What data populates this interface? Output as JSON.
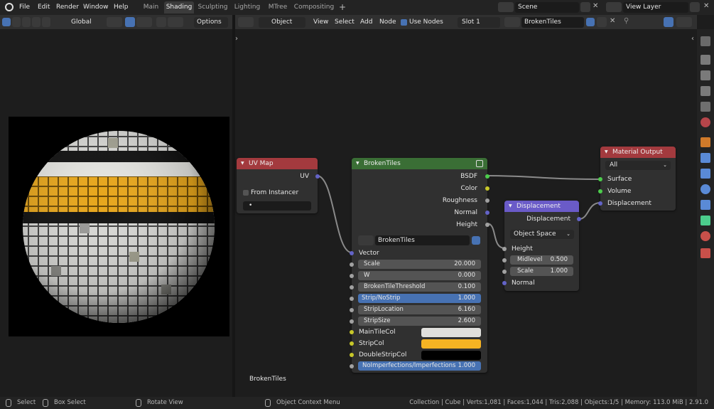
{
  "menu": {
    "file": "File",
    "edit": "Edit",
    "render": "Render",
    "window": "Window",
    "help": "Help"
  },
  "workspaces": [
    "Main",
    "Shading",
    "Sculpting",
    "Lighting",
    "MTree",
    "Compositing"
  ],
  "active_workspace": "Shading",
  "scene": {
    "value": "Scene"
  },
  "view_layer": {
    "value": "View Layer"
  },
  "left_header": {
    "orientation": "Global",
    "options": "Options",
    "search_placeholder": ""
  },
  "node_header": {
    "object": "Object",
    "view": "View",
    "select": "Select",
    "add": "Add",
    "node": "Node",
    "use_nodes": "Use Nodes",
    "slot": "Slot 1",
    "material": "BrokenTiles"
  },
  "uv_node": {
    "title": "UV Map",
    "out_uv": "UV",
    "from_instancer": "From Instancer",
    "field_value": "•"
  },
  "broken_node": {
    "title": "BrokenTiles",
    "outputs": [
      "BSDF",
      "Color",
      "Roughness",
      "Normal",
      "Height"
    ],
    "group_name": "BrokenTiles",
    "vector": "Vector",
    "props": [
      {
        "label": "Scale",
        "value": "20.000"
      },
      {
        "label": "W",
        "value": "0.000"
      },
      {
        "label": "BrokenTileThreshold",
        "value": "0.100"
      },
      {
        "label": "Strip/NoStrip",
        "value": "1.000"
      },
      {
        "label": "StripLocation",
        "value": "6.160"
      },
      {
        "label": "StripSize",
        "value": "2.600"
      }
    ],
    "colors": [
      {
        "label": "MainTileCol",
        "color": "#e0dfdc"
      },
      {
        "label": "StripCol",
        "color": "#f5b323"
      },
      {
        "label": "DoubleStripCol",
        "color": "#000000"
      }
    ],
    "last": {
      "label": "NoImperfections/Imperfections",
      "value": "1.000"
    }
  },
  "disp_node": {
    "title": "Displacement",
    "out": "Displacement",
    "space": "Object Space",
    "height": "Height",
    "midlevel_label": "Midlevel",
    "midlevel": "0.500",
    "scale_label": "Scale",
    "scale": "1.000",
    "normal": "Normal"
  },
  "out_node": {
    "title": "Material Output",
    "target": "All",
    "surface": "Surface",
    "volume": "Volume",
    "displacement": "Displacement"
  },
  "editor_label": "BrokenTiles",
  "status": {
    "select": "Select",
    "box_select": "Box Select",
    "rotate": "Rotate View",
    "context": "Object Context Menu",
    "info": "Collection | Cube | Verts:1,081 | Faces:1,044 | Tris:2,088 | Objects:1/5 | Memory: 113.0 MiB | 2.91.0"
  },
  "colors": {
    "accent": "#4772b3",
    "uv_header": "#a33a3e",
    "group_header": "#3a6e35",
    "vector_header": "#6a5bc8",
    "output_header": "#a33a3e",
    "strip_color": "#f5b323"
  }
}
